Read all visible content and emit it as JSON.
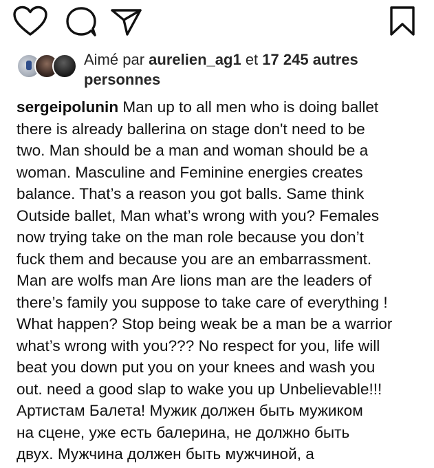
{
  "icons": {
    "like": "heart-icon",
    "comment": "comment-icon",
    "share": "share-icon",
    "save": "bookmark-icon"
  },
  "likes": {
    "prefix": "Aimé par",
    "user": "aurelien_ag1",
    "connector": "et",
    "count_bold": "17 245 autres",
    "suffix_bold": "personnes"
  },
  "caption": {
    "username": "sergeipolunin",
    "first_line_rest": " Man up to all men who is doing ballet",
    "lines": [
      "there is already ballerina on stage don't need to be",
      "two. Man should be a man and woman should be a",
      "woman. Masculine and Feminine energies creates",
      "balance. That’s a reason you got balls. Same think",
      "Outside ballet, Man what’s wrong with you? Females",
      "now trying take on the man role because you don’t",
      "fuck them and because you are an embarrassment.",
      "Man are wolfs man Are lions  man are the leaders of",
      "there’s family you suppose to take care of everything !",
      "What happen? Stop being weak be a man be a warrior",
      "what’s wrong with you??? No respect for you, life will",
      "beat you down put you on your knees and wash you",
      "out. need a good slap to wake you up Unbelievable!!!",
      "Артистам Балета! Мужик должен быть мужиком",
      "на сцене, уже есть балерина, не должно быть",
      "двух. Мужчина должен быть мужчиной, а"
    ]
  }
}
